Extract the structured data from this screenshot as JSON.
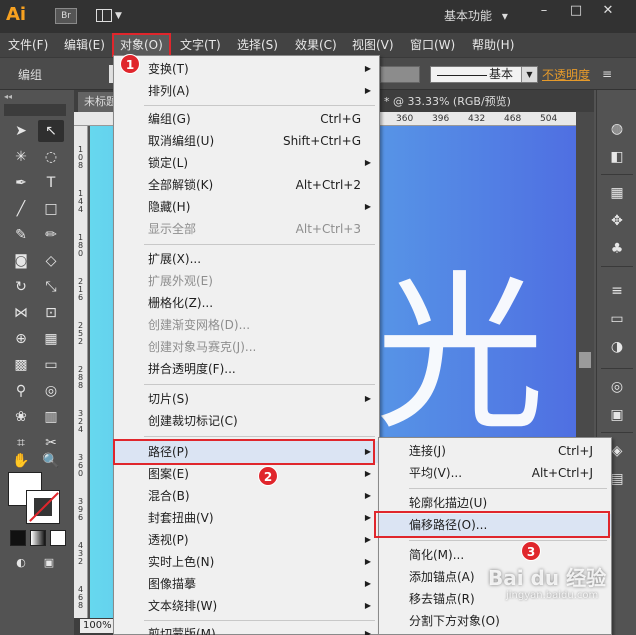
{
  "titlebar": {
    "logo": "Ai",
    "bridge": "Br",
    "workspace": "基本功能",
    "workspace_caret": "▾",
    "minimize": "–",
    "restore": "□",
    "close": "✕"
  },
  "menubar": [
    {
      "label": "文件(F)"
    },
    {
      "label": "编辑(E)"
    },
    {
      "label": "对象(O)"
    },
    {
      "label": "文字(T)"
    },
    {
      "label": "选择(S)"
    },
    {
      "label": "效果(C)"
    },
    {
      "label": "视图(V)"
    },
    {
      "label": "窗口(W)"
    },
    {
      "label": "帮助(H)"
    }
  ],
  "controlbar": {
    "label": "编组",
    "stroke_style": "基本",
    "opacity": "不透明度"
  },
  "document": {
    "tab_left": "未标题",
    "tab_right": "* @ 33.33% (RGB/预览)",
    "zoom": "100%",
    "canvas_text": "光"
  },
  "ruler": {
    "h_ticks": [
      "360",
      "396",
      "432",
      "468",
      "504"
    ],
    "v_ticks": [
      "108",
      "144",
      "180",
      "216",
      "252",
      "288",
      "324",
      "360",
      "396",
      "432",
      "468"
    ]
  },
  "object_menu": {
    "items": [
      {
        "label": "变换(T)",
        "shortcut": "",
        "arrow": true,
        "disabled": false
      },
      {
        "label": "排列(A)",
        "shortcut": "",
        "arrow": true,
        "disabled": false
      },
      {
        "sep": true
      },
      {
        "label": "编组(G)",
        "shortcut": "Ctrl+G",
        "arrow": false,
        "disabled": false
      },
      {
        "label": "取消编组(U)",
        "shortcut": "Shift+Ctrl+G",
        "arrow": false,
        "disabled": false
      },
      {
        "label": "锁定(L)",
        "shortcut": "",
        "arrow": true,
        "disabled": false
      },
      {
        "label": "全部解锁(K)",
        "shortcut": "Alt+Ctrl+2",
        "arrow": false,
        "disabled": false
      },
      {
        "label": "隐藏(H)",
        "shortcut": "",
        "arrow": true,
        "disabled": false
      },
      {
        "label": "显示全部",
        "shortcut": "Alt+Ctrl+3",
        "arrow": false,
        "disabled": true
      },
      {
        "sep": true
      },
      {
        "label": "扩展(X)...",
        "shortcut": "",
        "arrow": false,
        "disabled": false
      },
      {
        "label": "扩展外观(E)",
        "shortcut": "",
        "arrow": false,
        "disabled": true
      },
      {
        "label": "栅格化(Z)...",
        "shortcut": "",
        "arrow": false,
        "disabled": false
      },
      {
        "label": "创建渐变网格(D)...",
        "shortcut": "",
        "arrow": false,
        "disabled": true
      },
      {
        "label": "创建对象马赛克(J)...",
        "shortcut": "",
        "arrow": false,
        "disabled": true
      },
      {
        "label": "拼合透明度(F)...",
        "shortcut": "",
        "arrow": false,
        "disabled": false
      },
      {
        "sep": true
      },
      {
        "label": "切片(S)",
        "shortcut": "",
        "arrow": true,
        "disabled": false
      },
      {
        "label": "创建裁切标记(C)",
        "shortcut": "",
        "arrow": false,
        "disabled": false
      },
      {
        "sep": true
      },
      {
        "label": "路径(P)",
        "shortcut": "",
        "arrow": true,
        "disabled": false,
        "highlight": true
      },
      {
        "label": "图案(E)",
        "shortcut": "",
        "arrow": true,
        "disabled": false
      },
      {
        "label": "混合(B)",
        "shortcut": "",
        "arrow": true,
        "disabled": false
      },
      {
        "label": "封套扭曲(V)",
        "shortcut": "",
        "arrow": true,
        "disabled": false
      },
      {
        "label": "透视(P)",
        "shortcut": "",
        "arrow": true,
        "disabled": false
      },
      {
        "label": "实时上色(N)",
        "shortcut": "",
        "arrow": true,
        "disabled": false
      },
      {
        "label": "图像描摹",
        "shortcut": "",
        "arrow": true,
        "disabled": false
      },
      {
        "label": "文本绕排(W)",
        "shortcut": "",
        "arrow": true,
        "disabled": false
      },
      {
        "sep": true
      },
      {
        "label": "剪切蒙版(M)",
        "shortcut": "",
        "arrow": true,
        "disabled": false
      }
    ]
  },
  "path_submenu": {
    "items": [
      {
        "label": "连接(J)",
        "shortcut": "Ctrl+J"
      },
      {
        "label": "平均(V)...",
        "shortcut": "Alt+Ctrl+J"
      },
      {
        "sep": true
      },
      {
        "label": "轮廓化描边(U)",
        "shortcut": ""
      },
      {
        "label": "偏移路径(O)...",
        "shortcut": "",
        "highlight": true
      },
      {
        "sep": true
      },
      {
        "label": "简化(M)...",
        "shortcut": ""
      },
      {
        "label": "添加锚点(A)",
        "shortcut": ""
      },
      {
        "label": "移去锚点(R)",
        "shortcut": ""
      },
      {
        "label": "分割下方对象(O)",
        "shortcut": ""
      }
    ]
  },
  "badges": [
    "1",
    "2",
    "3"
  ],
  "watermark": {
    "main": "Bai du 经验",
    "sub": "jingyan.baidu.com"
  },
  "colors": {
    "accent_red": "#e0262c",
    "ai_orange": "#f7a120",
    "opacity_link": "#e59a2b"
  },
  "icons": {
    "selection": "selection-tool-icon",
    "direct_selection": "direct-selection-tool-icon",
    "pen": "pen-tool-icon",
    "type": "type-tool-icon",
    "hand": "hand-tool-icon",
    "zoom": "zoom-tool-icon"
  }
}
